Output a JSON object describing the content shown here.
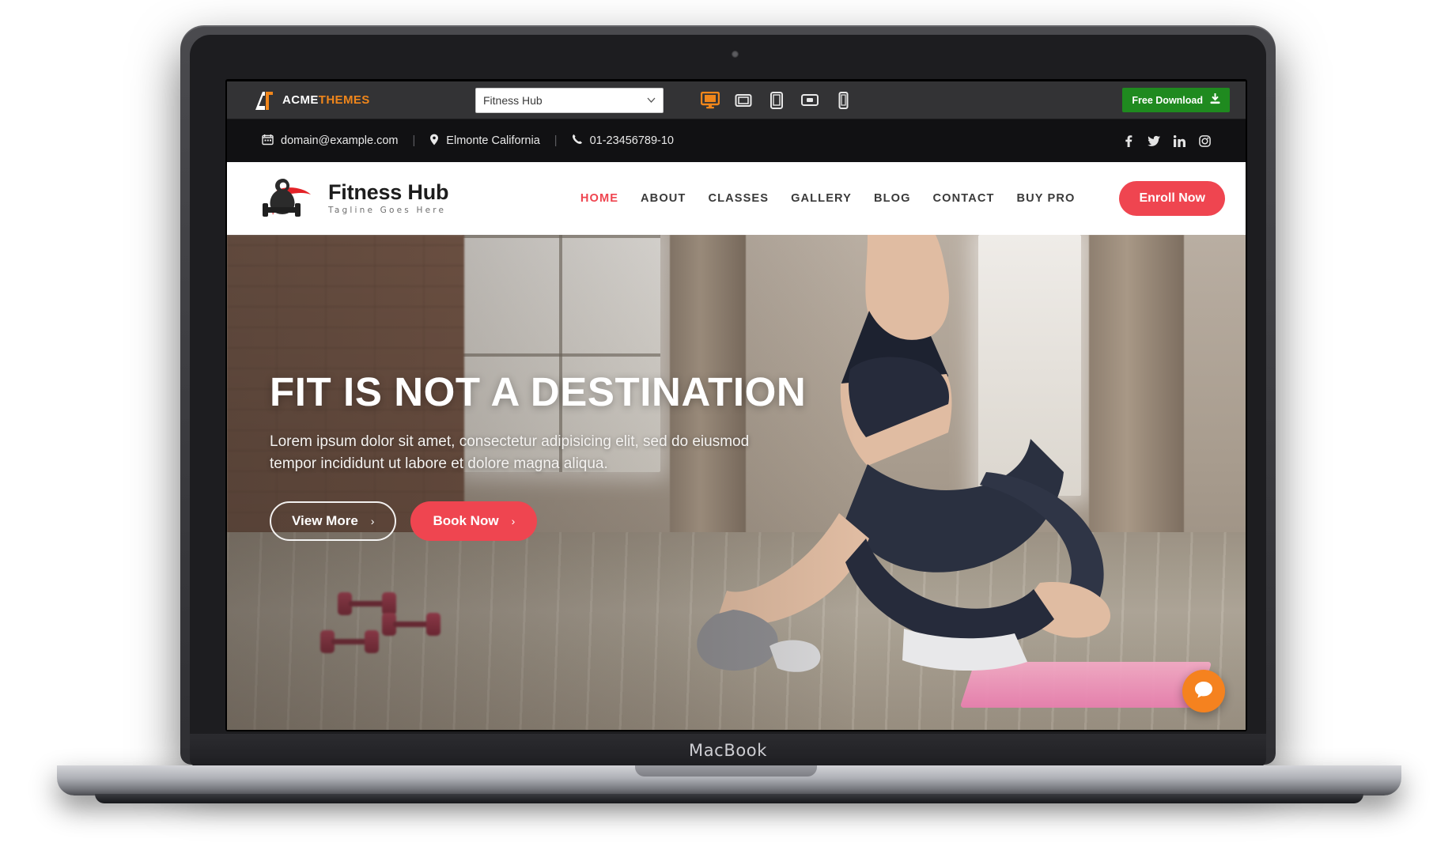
{
  "mockup": {
    "device_label": "MacBook"
  },
  "toolbar": {
    "logo_white": "ACME",
    "logo_orange": "THEMES",
    "theme_select": {
      "value": "Fitness Hub",
      "chevron": "⌄"
    },
    "devices": [
      {
        "name": "desktop-preview",
        "active": true
      },
      {
        "name": "laptop-preview",
        "active": false
      },
      {
        "name": "tablet-portrait-preview",
        "active": false
      },
      {
        "name": "tablet-landscape-preview",
        "active": false
      },
      {
        "name": "mobile-preview",
        "active": false
      }
    ],
    "download_label": "Free Download",
    "download_icon": "download-icon",
    "download_color": "#1f8a1f"
  },
  "infobar": {
    "email": "domain@example.com",
    "email_icon": "envelope-icon",
    "address": "Elmonte California",
    "address_icon": "map-pin-icon",
    "phone": "01-23456789-10",
    "phone_icon": "phone-icon",
    "separator": "|",
    "socials": [
      "facebook-icon",
      "twitter-icon",
      "linkedin-icon",
      "instagram-icon"
    ]
  },
  "header": {
    "brand_name": "Fitness Hub",
    "brand_tagline": "Tagline Goes Here",
    "menu": [
      {
        "label": "HOME",
        "active": true
      },
      {
        "label": "ABOUT",
        "active": false
      },
      {
        "label": "CLASSES",
        "active": false
      },
      {
        "label": "GALLERY",
        "active": false
      },
      {
        "label": "BLOG",
        "active": false
      },
      {
        "label": "CONTACT",
        "active": false
      },
      {
        "label": "BUY PRO",
        "active": false
      }
    ],
    "cta_label": "Enroll Now",
    "accent_color": "#ef4550"
  },
  "hero": {
    "title": "FIT IS NOT A DESTINATION",
    "subtitle": "Lorem ipsum dolor sit amet, consectetur adipisicing elit, sed do eiusmod tempor incididunt ut labore et dolore magna aliqua.",
    "primary_button": "View More",
    "secondary_button": "Book Now",
    "button_chevron": "›"
  },
  "chat_widget": {
    "icon": "chat-bubble-icon",
    "color": "#f5821f"
  }
}
